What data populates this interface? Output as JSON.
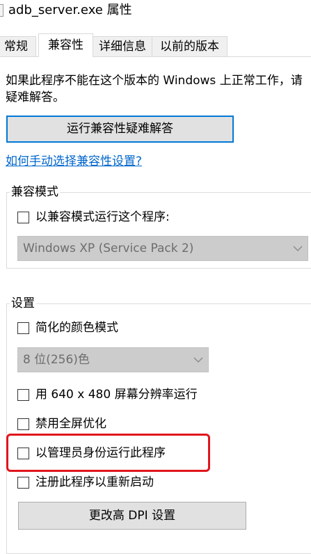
{
  "window": {
    "title": "adb_server.exe 属性"
  },
  "tabs": [
    {
      "label": "常规"
    },
    {
      "label": "兼容性"
    },
    {
      "label": "详细信息"
    },
    {
      "label": "以前的版本"
    }
  ],
  "compat": {
    "description_line1": "如果此程序不能在这个版本的 Windows 上正常工作，请",
    "description_line2": "疑难解答。",
    "troubleshoot_button": "运行兼容性疑难解答",
    "manual_link": "如何手动选择兼容性设置?"
  },
  "compat_mode": {
    "group_label": "兼容模式",
    "checkbox_label": "以兼容模式运行这个程序:",
    "checkbox_checked": false,
    "os_select_value": "Windows XP (Service Pack 2)"
  },
  "settings": {
    "group_label": "设置",
    "reduced_color": {
      "label": "简化的颜色模式",
      "checked": false
    },
    "color_select_value": "8 位(256)色",
    "res_640": {
      "label": "用 640 x 480 屏幕分辨率运行",
      "checked": false
    },
    "disable_fullscreen_opt": {
      "label": "禁用全屏优化",
      "checked": false
    },
    "run_as_admin": {
      "label": "以管理员身份运行此程序",
      "checked": false
    },
    "register_restart": {
      "label": "注册此程序以重新启动",
      "checked": false
    },
    "dpi_button": "更改高 DPI 设置"
  },
  "colors": {
    "accent": "#0078d7",
    "link": "#0066cc",
    "highlight": "#e0151c"
  }
}
